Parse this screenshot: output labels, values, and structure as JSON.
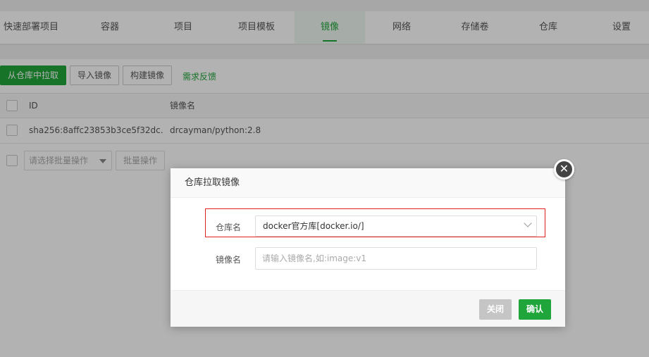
{
  "nav": {
    "tabs": [
      {
        "label": "快速部署项目",
        "active": false
      },
      {
        "label": "容器",
        "active": false
      },
      {
        "label": "项目",
        "active": false
      },
      {
        "label": "项目模板",
        "active": false
      },
      {
        "label": "镜像",
        "active": true
      },
      {
        "label": "网络",
        "active": false
      },
      {
        "label": "存储卷",
        "active": false
      },
      {
        "label": "仓库",
        "active": false
      },
      {
        "label": "设置",
        "active": false
      }
    ]
  },
  "toolbar": {
    "pull_label": "从仓库中拉取",
    "import_label": "导入镜像",
    "build_label": "构建镜像",
    "feedback_label": "需求反馈"
  },
  "table": {
    "headers": {
      "id": "ID",
      "name": "镜像名"
    },
    "rows": [
      {
        "id": "sha256:8affc23853b3ce5f32dc...",
        "name": "drcayman/python:2.8"
      }
    ]
  },
  "footer": {
    "batch_placeholder": "请选择批量操作",
    "batch_button": "批量操作"
  },
  "modal": {
    "title": "仓库拉取镜像",
    "repo_label": "仓库名",
    "repo_value": "docker官方库[docker.io/]",
    "image_label": "镜像名",
    "image_placeholder": "请输入镜像名,如:image:v1",
    "close_label": "关闭",
    "confirm_label": "确认"
  },
  "colors": {
    "accent": "#20a53a",
    "highlight": "#e02020"
  }
}
